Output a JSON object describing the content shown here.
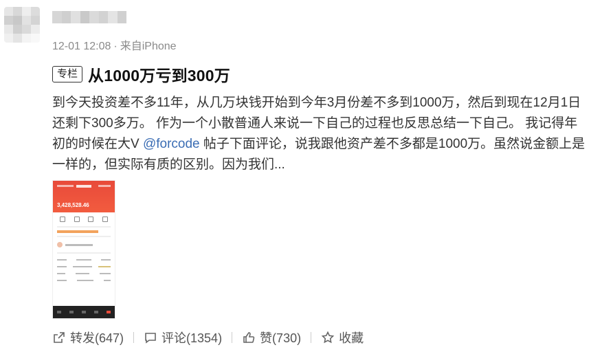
{
  "post": {
    "meta": {
      "time": "12-01 12:08",
      "separator": "·",
      "source": "来自iPhone"
    },
    "tag": "专栏",
    "title": "从1000万亏到300万",
    "body_before": "到今天投资差不多11年，从几万块钱开始到今年3月份差不多到1000万，然后到现在12月1日还剩下300多万。 作为一个小散普通人来说一下自己的过程也反思总结一下自己。 我记得年初的时候在大V ",
    "mention": "@forcode",
    "body_after": " 帖子下面评论，说我跟他资产差不多都是1000万。虽然说金额上是一样的，但实际有质的区别。因为我们...",
    "image_amount": "3,428,528.46"
  },
  "actions": {
    "repost": "转发(647)",
    "comment": "评论(1354)",
    "like": "赞(730)",
    "favorite": "收藏"
  },
  "colors": {
    "accent_red": "#e84a3a",
    "link_blue": "#3b6db4"
  }
}
